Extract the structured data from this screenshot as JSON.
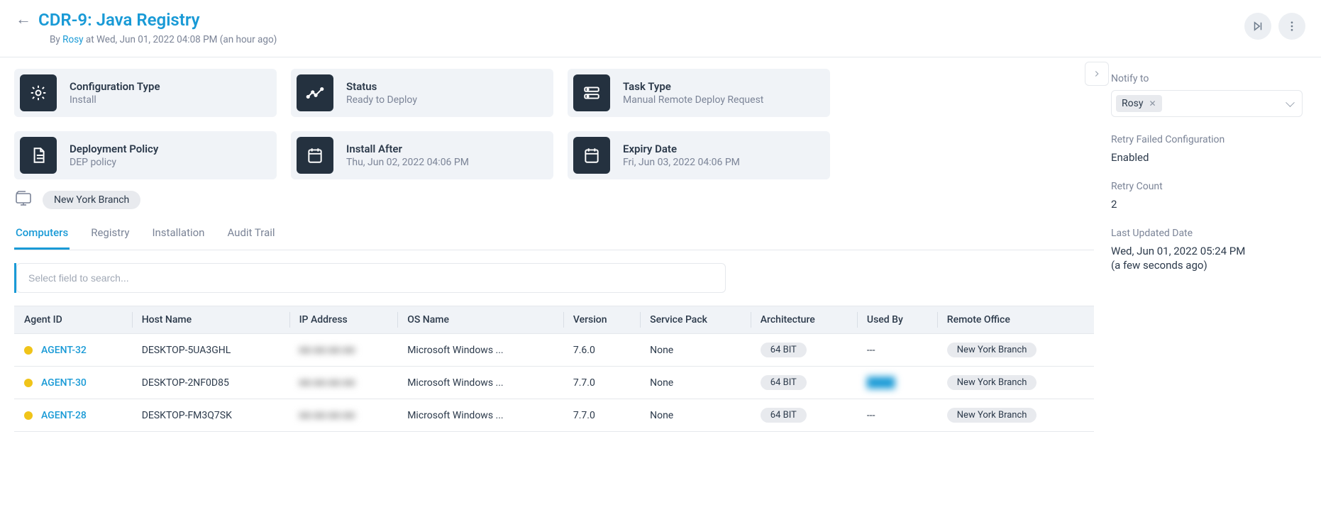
{
  "header": {
    "title": "CDR-9: Java Registry",
    "by_label": "By",
    "by_user": "Rosy",
    "by_rest": "at Wed, Jun 01, 2022 04:08 PM (an hour ago)"
  },
  "cards": [
    {
      "icon": "gear",
      "label": "Configuration Type",
      "value": "Install"
    },
    {
      "icon": "trend",
      "label": "Status",
      "value": "Ready to Deploy"
    },
    {
      "icon": "stack",
      "label": "Task Type",
      "value": "Manual Remote Deploy Request"
    },
    {
      "icon": "doc",
      "label": "Deployment Policy",
      "value": "DEP policy"
    },
    {
      "icon": "calendar",
      "label": "Install After",
      "value": "Thu, Jun 02, 2022 04:06 PM"
    },
    {
      "icon": "calendar",
      "label": "Expiry Date",
      "value": "Fri, Jun 03, 2022 04:06 PM"
    }
  ],
  "scope": {
    "label": "New York Branch"
  },
  "tabs": [
    {
      "label": "Computers",
      "active": true
    },
    {
      "label": "Registry",
      "active": false
    },
    {
      "label": "Installation",
      "active": false
    },
    {
      "label": "Audit Trail",
      "active": false
    }
  ],
  "search": {
    "placeholder": "Select field to search..."
  },
  "table": {
    "columns": [
      "Agent ID",
      "Host Name",
      "IP Address",
      "OS Name",
      "Version",
      "Service Pack",
      "Architecture",
      "Used By",
      "Remote Office"
    ],
    "rows": [
      {
        "agent": "AGENT-32",
        "host": "DESKTOP-5UA3GHL",
        "ip": "■■.■■.■■.■■",
        "os": "Microsoft Windows ...",
        "version": "7.6.0",
        "sp": "None",
        "arch": "64 BIT",
        "used_by": "---",
        "office": "New York Branch",
        "used_by_blur": false
      },
      {
        "agent": "AGENT-30",
        "host": "DESKTOP-2NF0D85",
        "ip": "■■.■■.■■.■■",
        "os": "Microsoft Windows ...",
        "version": "7.7.0",
        "sp": "None",
        "arch": "64 BIT",
        "used_by": "████",
        "office": "New York Branch",
        "used_by_blur": true
      },
      {
        "agent": "AGENT-28",
        "host": "DESKTOP-FM3Q7SK",
        "ip": "■■.■■.■■.■■",
        "os": "Microsoft Windows ...",
        "version": "7.7.0",
        "sp": "None",
        "arch": "64 BIT",
        "used_by": "---",
        "office": "New York Branch",
        "used_by_blur": false
      }
    ]
  },
  "side": {
    "notify_label": "Notify to",
    "notify_value": "Rosy",
    "retry_failed_label": "Retry Failed Configuration",
    "retry_failed_value": "Enabled",
    "retry_count_label": "Retry Count",
    "retry_count_value": "2",
    "updated_label": "Last Updated Date",
    "updated_value": "Wed, Jun 01, 2022 05:24 PM",
    "updated_ago": "(a few seconds ago)"
  }
}
